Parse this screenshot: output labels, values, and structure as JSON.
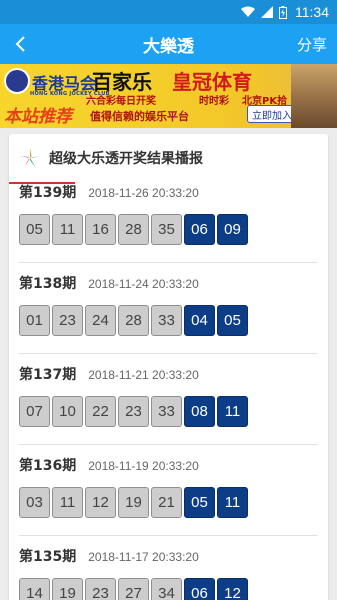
{
  "status_bar": {
    "time": "11:34"
  },
  "app_bar": {
    "title": "大樂透",
    "share_label": "分享"
  },
  "banner": {
    "hk_title": "香港马会",
    "hk_sub": "HONG KONG JOCKEY CLUB",
    "baijia": "百家乐",
    "huangguan": "皇冠体育",
    "liuhe": "六合彩每日开奖",
    "shishicai": "时时彩",
    "pk10": "北京PK拾",
    "recommend": "本站推荐",
    "slogan": "值得信赖的娱乐平台",
    "join_label": "立即加入"
  },
  "card": {
    "title": "超级大乐透开奖结果播报"
  },
  "draws": [
    {
      "issue": "第139期",
      "date": "2018-11-26 20:33:20",
      "front": [
        "05",
        "11",
        "16",
        "28",
        "35"
      ],
      "back": [
        "06",
        "09"
      ]
    },
    {
      "issue": "第138期",
      "date": "2018-11-24 20:33:20",
      "front": [
        "01",
        "23",
        "24",
        "28",
        "33"
      ],
      "back": [
        "04",
        "05"
      ]
    },
    {
      "issue": "第137期",
      "date": "2018-11-21 20:33:20",
      "front": [
        "07",
        "10",
        "22",
        "23",
        "33"
      ],
      "back": [
        "08",
        "11"
      ]
    },
    {
      "issue": "第136期",
      "date": "2018-11-19 20:33:20",
      "front": [
        "03",
        "11",
        "12",
        "19",
        "21"
      ],
      "back": [
        "05",
        "11"
      ]
    },
    {
      "issue": "第135期",
      "date": "2018-11-17 20:33:20",
      "front": [
        "14",
        "19",
        "23",
        "27",
        "34"
      ],
      "back": [
        "06",
        "12"
      ]
    }
  ]
}
